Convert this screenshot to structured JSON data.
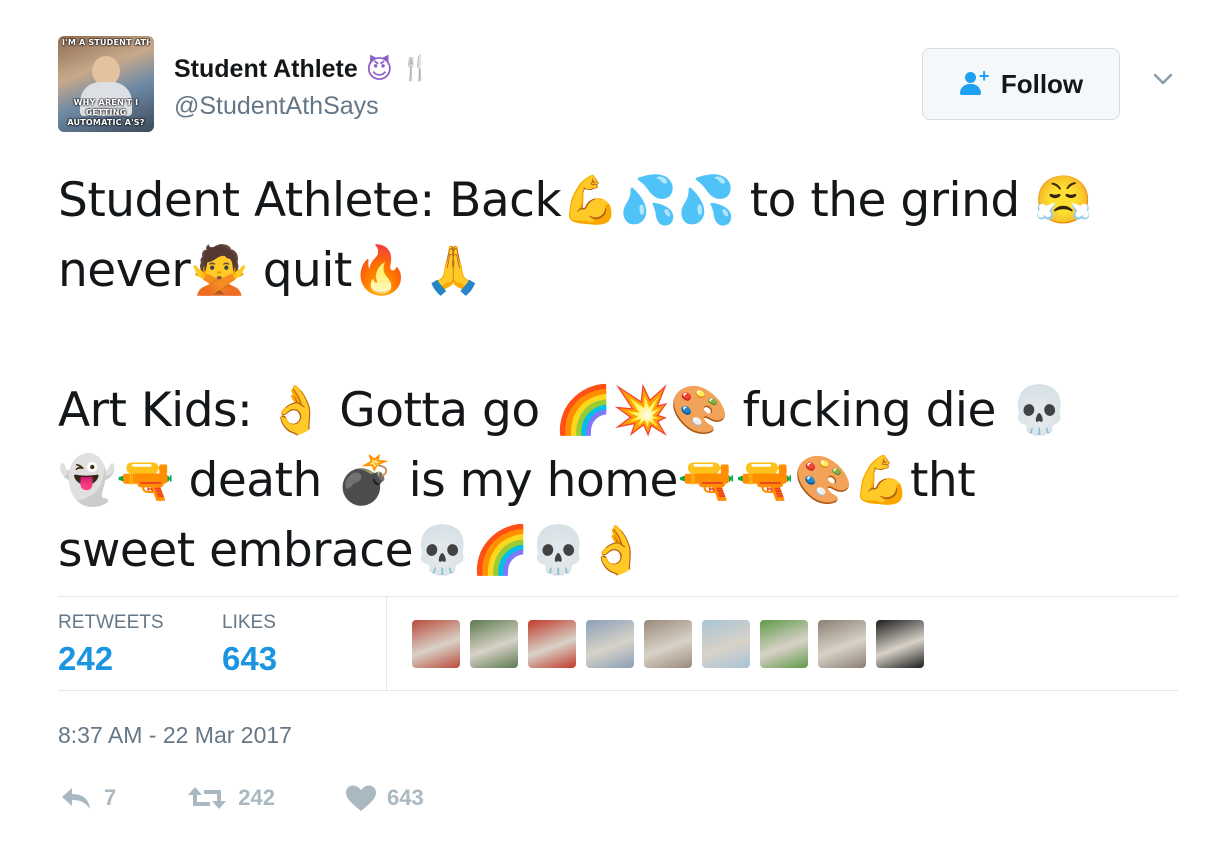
{
  "author": {
    "display_name": "Student Athlete",
    "name_emojis": [
      "devil-face-emoji",
      "fork-knife-emoji"
    ],
    "handle": "@StudentAthSays",
    "avatar": {
      "top_text": "I'M A STUDENT ATHLETE",
      "bottom_text": "WHY AREN'T I GETTING AUTOMATIC A'S?"
    }
  },
  "follow_button": {
    "label": "Follow",
    "icon": "add-user-icon"
  },
  "more_menu": {
    "icon": "chevron-down-icon"
  },
  "tweet": {
    "lines": [
      "Student Athlete: Back💪💦💦 to the grind 😤",
      "never🙅 quit🔥 🙏",
      "",
      "Art Kids: 👌 Gotta go 🌈💥🎨 fucking die 💀",
      "👻🔫 death 💣 is my home🔫🔫🎨💪tht",
      "sweet embrace💀🌈💀👌"
    ]
  },
  "stats": {
    "retweets_label": "RETWEETS",
    "retweets": "242",
    "likes_label": "LIKES",
    "likes": "643"
  },
  "likers": [
    {
      "icon": "liker-avatar",
      "color": "#b94a3a"
    },
    {
      "icon": "liker-avatar",
      "color": "#5a7a4e"
    },
    {
      "icon": "liker-avatar",
      "color": "#c0392b"
    },
    {
      "icon": "liker-avatar",
      "color": "#8aa0b8"
    },
    {
      "icon": "liker-avatar",
      "color": "#9a8b7a"
    },
    {
      "icon": "liker-avatar",
      "color": "#a7c4d6"
    },
    {
      "icon": "liker-avatar",
      "color": "#5f9a4a"
    },
    {
      "icon": "liker-avatar",
      "color": "#8c7f74"
    },
    {
      "icon": "liker-avatar",
      "color": "#1c1c1c"
    }
  ],
  "timestamp": "8:37 AM - 22 Mar 2017",
  "actions": {
    "reply_count": "7",
    "retweet_count": "242",
    "like_count": "643"
  },
  "colors": {
    "link_blue": "#1b95e0",
    "follow_blue": "#1da1f2",
    "muted_gray": "#657786",
    "action_gray": "#aab8c2"
  }
}
